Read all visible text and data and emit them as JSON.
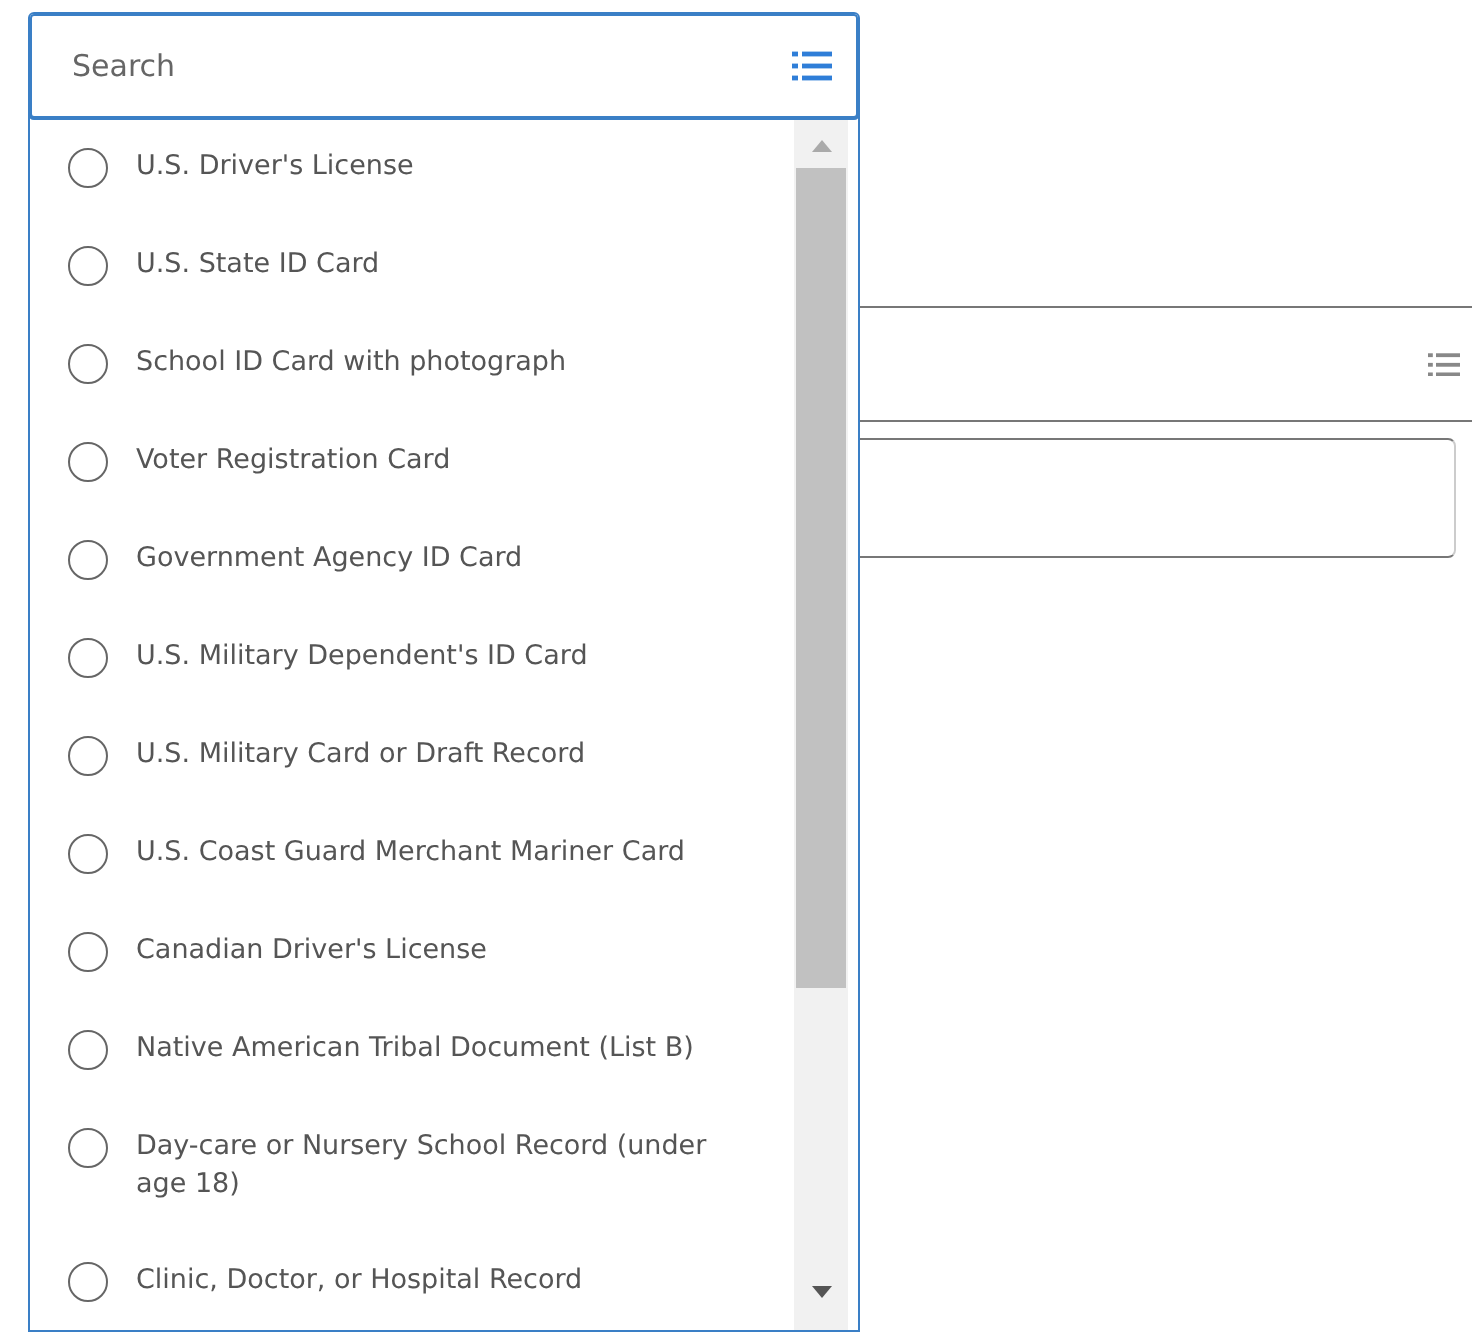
{
  "search": {
    "placeholder": "Search"
  },
  "options": [
    {
      "label": "U.S. Driver's License",
      "selected": false
    },
    {
      "label": "U.S. State ID Card",
      "selected": false
    },
    {
      "label": "School ID Card with photograph",
      "selected": false
    },
    {
      "label": "Voter Registration Card",
      "selected": false
    },
    {
      "label": "Government Agency ID Card",
      "selected": false
    },
    {
      "label": "U.S. Military Dependent's ID Card",
      "selected": false
    },
    {
      "label": "U.S. Military Card or Draft Record",
      "selected": false
    },
    {
      "label": "U.S. Coast Guard Merchant Mariner Card",
      "selected": false
    },
    {
      "label": "Canadian Driver's License",
      "selected": false
    },
    {
      "label": "Native American Tribal Document (List B)",
      "selected": false
    },
    {
      "label": "Day-care or Nursery School Record (under age 18)",
      "selected": false
    },
    {
      "label": "Clinic, Doctor, or Hospital Record",
      "selected": false
    }
  ]
}
